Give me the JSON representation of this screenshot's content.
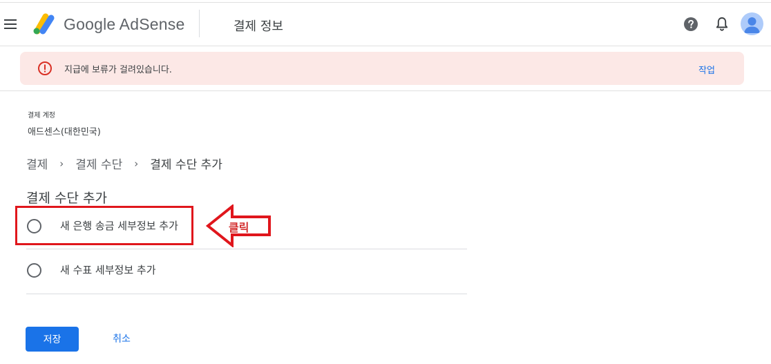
{
  "header": {
    "brand": "Google AdSense",
    "title": "결제 정보",
    "icons": [
      "menu-icon",
      "help-icon",
      "bell-icon",
      "avatar"
    ]
  },
  "alert": {
    "icon": "alert-circle-icon",
    "message": "지급에 보류가 걸려있습니다.",
    "action": "작업",
    "color": "#fce8e6"
  },
  "account": {
    "label": "결제 계정",
    "name": "애드센스(대한민국)"
  },
  "breadcrumb": {
    "items": [
      "결제",
      "결제 수단",
      "결제 수단 추가"
    ],
    "separator": "›"
  },
  "section": {
    "title": "결제 수단 추가",
    "options": [
      {
        "label": "새 은행 송금 세부정보 추가",
        "selected": false
      },
      {
        "label": "새 수표 세부정보 추가",
        "selected": false
      }
    ]
  },
  "annotation": {
    "arrow_text": "클릭",
    "color": "#e0161c"
  },
  "actions": {
    "save": "저장",
    "cancel": "취소"
  },
  "colors": {
    "accent": "#1a73e8",
    "alert_bg": "#fce8e6",
    "alert_icon": "#d93025"
  }
}
